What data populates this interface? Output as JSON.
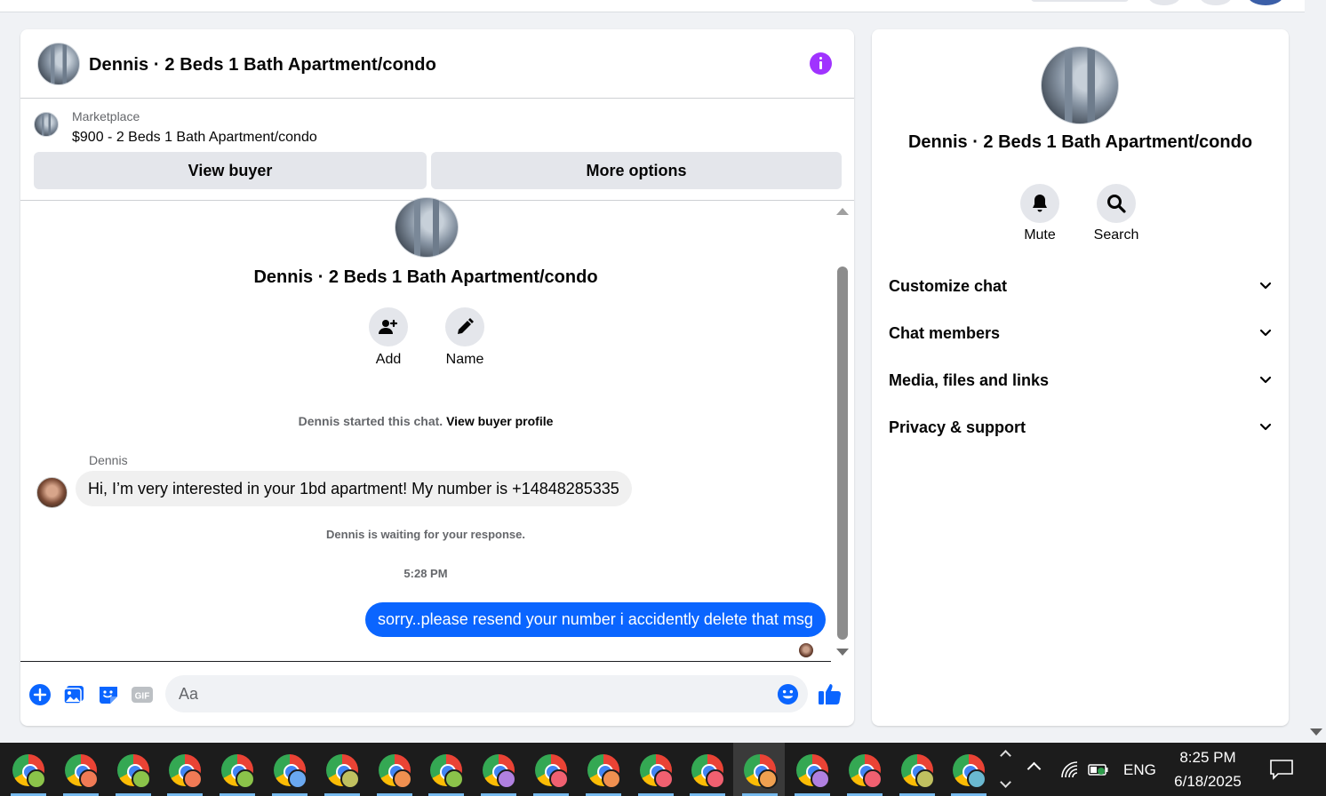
{
  "chat": {
    "header_title": "Dennis · 2 Beds 1 Bath Apartment/condo",
    "marketplace_label": "Marketplace",
    "listing_text": "$900 - 2 Beds 1 Bath Apartment/condo",
    "view_buyer_label": "View buyer",
    "more_options_label": "More options",
    "thread_title": "Dennis · 2 Beds 1 Bath Apartment/condo",
    "add_label": "Add",
    "name_label": "Name",
    "started_text": "Dennis started this chat.",
    "view_profile_link": "View buyer profile",
    "sender_name": "Dennis",
    "incoming_message": "Hi, I’m very interested in your 1bd apartment! My number is +14848285335",
    "waiting_text": "Dennis is waiting for your response.",
    "timestamp": "5:28 PM",
    "outgoing_message": "sorry..please resend your number i accidently delete that msg",
    "composer_placeholder": "Aa",
    "composer_value": ""
  },
  "details": {
    "title": "Dennis · 2 Beds 1 Bath Apartment/condo",
    "mute_label": "Mute",
    "search_label": "Search",
    "sections": [
      {
        "label": "Customize chat"
      },
      {
        "label": "Chat members"
      },
      {
        "label": "Media, files and links"
      },
      {
        "label": "Privacy & support"
      }
    ]
  },
  "colors": {
    "accent_blue": "#0a65ff",
    "info_purple": "#a033ff",
    "bubble_grey": "#f0f0f0"
  },
  "taskbar": {
    "badge_colors": [
      "#8bc34a",
      "#f07a55",
      "#8bc34a",
      "#f07a55",
      "#8bc34a",
      "#6aa8f0",
      "#c0c060",
      "#f09050",
      "#8bc34a",
      "#b080e0",
      "#f06070",
      "#f09050",
      "#f06070",
      "#f06070",
      "#f0a050",
      "#b080e0",
      "#f06070",
      "#c0c060",
      "#6ab8d0"
    ],
    "active_index": 14,
    "language": "ENG",
    "time": "8:25 PM",
    "date": "6/18/2025"
  }
}
